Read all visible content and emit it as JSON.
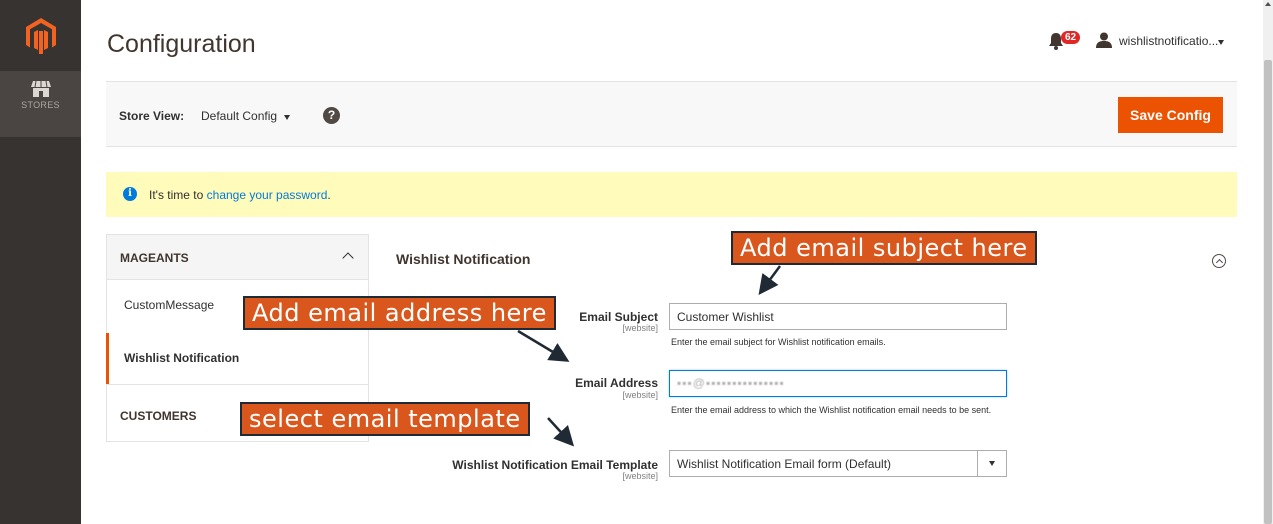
{
  "sidebar": {
    "logo_icon": "magento-logo-icon",
    "stores_label": "STORES",
    "stores_icon": "store-icon"
  },
  "header": {
    "title": "Configuration",
    "notifications_count": "62",
    "username": "wishlistnotificatio..."
  },
  "store_bar": {
    "label": "Store View:",
    "selected": "Default Config",
    "save_label": "Save Config",
    "help_glyph": "?"
  },
  "notice": {
    "prefix": "It's time to ",
    "link": "change your password",
    "suffix": "."
  },
  "left_nav": {
    "section1": "MAGEANTS",
    "items": [
      "CustomMessage",
      "Wishlist Notification"
    ],
    "section2": "CUSTOMERS"
  },
  "main": {
    "section_title": "Wishlist Notification",
    "fields": [
      {
        "label": "Email Subject",
        "scope": "[website]",
        "value": "Customer Wishlist",
        "note": "Enter the email subject for Wishlist notification emails."
      },
      {
        "label": "Email Address",
        "scope": "[website]",
        "value": "",
        "note": "Enter the email address to which the Wishlist notification email needs to be sent."
      },
      {
        "label": "Wishlist Notification Email Template",
        "scope": "[website]",
        "value": "Wishlist Notification Email form (Default)"
      }
    ]
  },
  "annotations": {
    "subject": "Add email subject here",
    "address": "Add email address here",
    "template": "select email template"
  },
  "colors": {
    "accent": "#eb5202",
    "sidebar": "#373330",
    "callout": "#d9571d",
    "link": "#007bdb"
  }
}
